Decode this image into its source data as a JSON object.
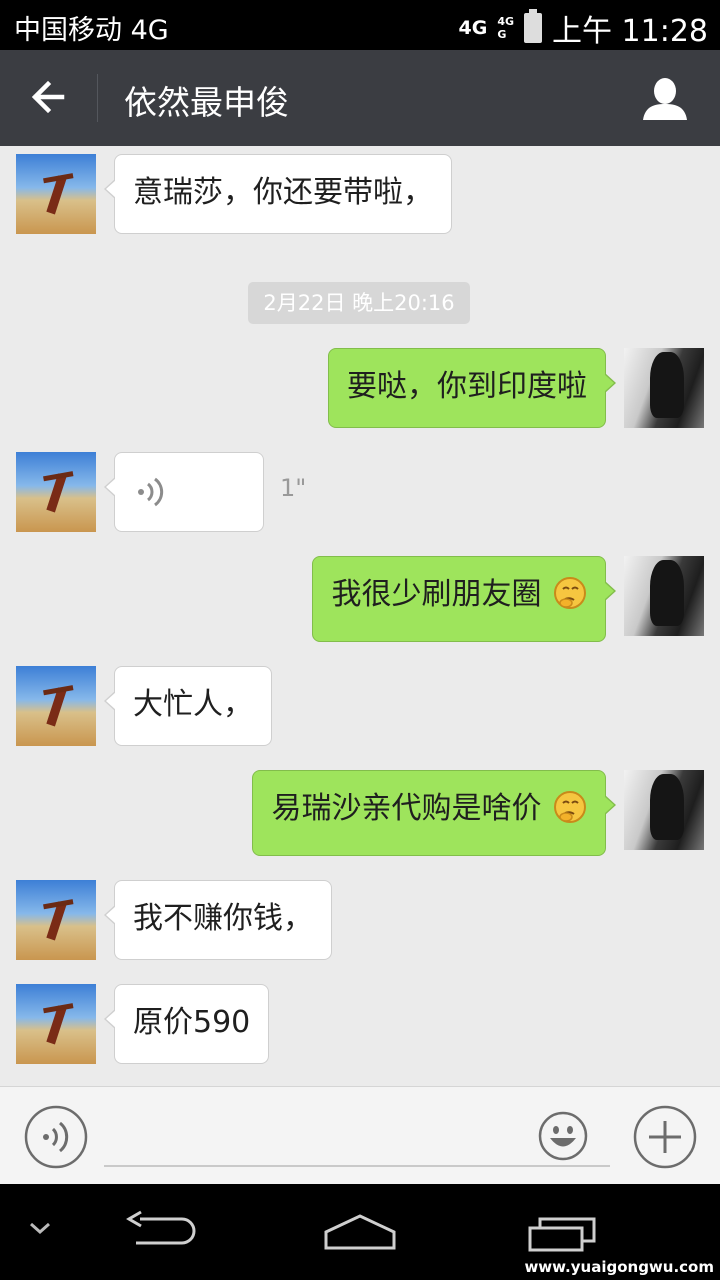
{
  "status_bar": {
    "carrier": "中国移动 4G",
    "network_main": "4G",
    "network_top": "4G",
    "network_bottom": "G",
    "time": "上午 11:28"
  },
  "header": {
    "title": "依然最申俊",
    "back_icon": "arrow-left-icon",
    "profile_icon": "person-icon"
  },
  "chat": {
    "timestamp": "2月22日 晚上20:16",
    "messages": [
      {
        "side": "left",
        "type": "text",
        "text": "意瑞莎，你还要带啦，"
      },
      {
        "side": "right",
        "type": "text",
        "text": "要哒，你到印度啦"
      },
      {
        "side": "left",
        "type": "voice",
        "duration": "1\""
      },
      {
        "side": "right",
        "type": "text",
        "text": "我很少刷朋友圈",
        "emoji": "thinking-face"
      },
      {
        "side": "left",
        "type": "text",
        "text": "大忙人，"
      },
      {
        "side": "right",
        "type": "text",
        "text": "易瑞沙亲代购是啥价",
        "emoji": "thinking-face"
      },
      {
        "side": "left",
        "type": "text",
        "text": "我不赚你钱，"
      },
      {
        "side": "left",
        "type": "text",
        "text": "原价590"
      }
    ]
  },
  "input_bar": {
    "voice_icon": "voice-input-icon",
    "placeholder": "",
    "emoji_icon": "smiley-icon",
    "plus_icon": "plus-icon"
  },
  "nav_bar": {
    "icons": [
      "chevron-down-icon",
      "back-icon",
      "home-icon",
      "recent-apps-icon"
    ],
    "watermark": "www.yuaigongwu.com"
  },
  "colors": {
    "header_bg": "#3b3d42",
    "chat_bg": "#ebebeb",
    "sent_bubble": "#9ee45c",
    "received_bubble": "#ffffff"
  }
}
